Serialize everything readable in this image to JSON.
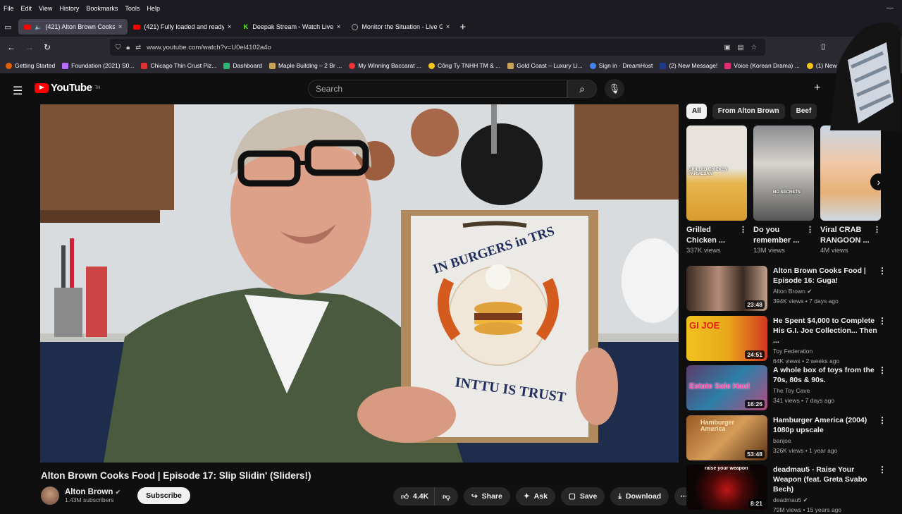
{
  "menubar": [
    "File",
    "Edit",
    "View",
    "History",
    "Bookmarks",
    "Tools",
    "Help"
  ],
  "tabs": [
    {
      "title": "(421) Alton Brown Cooks F…",
      "icon": "youtube"
    },
    {
      "title": "(421) Fully loaded and ready to…",
      "icon": "youtube"
    },
    {
      "title": "Deepak Stream - Watch Live…",
      "icon": "kick"
    },
    {
      "title": "Monitor the Situation - Live Glo…",
      "icon": "monitor"
    }
  ],
  "url": "www.youtube.com/watch?v=U0el4102a4o",
  "bookmarks": [
    "Getting Started",
    "Foundation (2021) S0...",
    "Chicago Thin Crust Piz...",
    "Dashboard",
    "Maple Building – 2 Br ...",
    "My Winning Baccarat ...",
    "Công Ty TNHH TM & ...",
    "Gold Coast – Luxury Li...",
    "Sign in · DreamHost",
    "(2) New Message!",
    "Voice (Korean Drama) ...",
    "(1) New Messa..."
  ],
  "youtube": {
    "logo": "YouTube",
    "logo_sup": "TH",
    "search_placeholder": "Search"
  },
  "video": {
    "title": "Alton Brown Cooks Food | Episode 17: Slip Slidin' (Sliders!)",
    "channel": "Alton Brown",
    "subscribers": "1.43M subscribers",
    "subscribe": "Subscribe",
    "likes": "4.4K",
    "share": "Share",
    "ask": "Ask",
    "save": "Save",
    "download": "Download",
    "sign_top": "IN BURGERS in TRS",
    "sign_bottom": "INTTU IS TRUST"
  },
  "chips": [
    "All",
    "From Alton Brown",
    "Beef"
  ],
  "shorts": [
    {
      "title": "Grilled Chicken ...",
      "views": "337K views",
      "thumb_text": "GRILLED CHICKEN PARMESAN"
    },
    {
      "title": "Do you remember ...",
      "views": "13M views",
      "thumb_text": "NO SECRETS"
    },
    {
      "title": "Viral CRAB RANGOON ...",
      "views": "4M views",
      "thumb_text": ""
    }
  ],
  "recs": [
    {
      "title": "Alton Brown Cooks Food | Episode 16: Guga!",
      "channel": "Alton Brown",
      "meta": "394K views • 7 days ago",
      "duration": "23:48",
      "color": "#5b3d2e"
    },
    {
      "title": "He Spent $4,000 to Complete His G.I. Joe Collection... Then ...",
      "channel": "Toy Federation",
      "meta": "64K views • 2 weeks ago",
      "duration": "24:51",
      "color": "#e7b820"
    },
    {
      "title": "A whole box of toys from the 70s, 80s & 90s.",
      "channel": "The Toy Cave",
      "meta": "341 views • 7 days ago",
      "duration": "16:26",
      "color": "#7a4b8c"
    },
    {
      "title": "Hamburger America (2004) 1080p upscale",
      "channel": "banjoe",
      "meta": "326K views • 1 year ago",
      "duration": "53:48",
      "color": "#8a4b1c"
    },
    {
      "title": "deadmau5 - Raise Your Weapon (feat. Greta Svabo Bech)",
      "channel": "deadmau5",
      "meta": "79M views • 15 years ago",
      "duration": "8:21",
      "color": "#1a0b0b"
    }
  ],
  "rec_thumb_texts": [
    "GI JOE",
    "Estate Sale Haul",
    "Hamburger America",
    "raise your weapon"
  ]
}
